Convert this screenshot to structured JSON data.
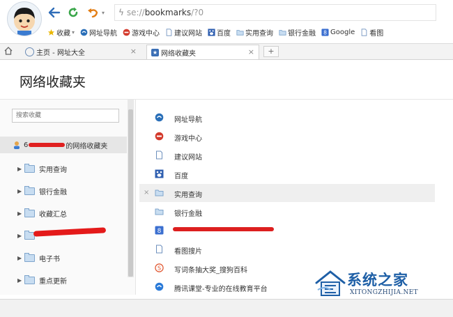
{
  "browser": {
    "address": {
      "scheme": "se://",
      "path": "bookmarks",
      "hash": "/?0"
    },
    "bookmarks_bar": [
      {
        "label": "收藏",
        "icon": "star-icon",
        "color": "#e9b600"
      },
      {
        "label": "网址导航",
        "icon": "sogou-nav-icon",
        "color": "#2a6fb8"
      },
      {
        "label": "游戏中心",
        "icon": "game-center-icon",
        "color": "#d33a2c"
      },
      {
        "label": "建议网站",
        "icon": "page-icon",
        "color": "#6c8fbd"
      },
      {
        "label": "百度",
        "icon": "baidu-icon",
        "color": "#2f5fb0"
      },
      {
        "label": "实用查询",
        "icon": "folder-icon",
        "color": "#7fa5cc"
      },
      {
        "label": "银行金融",
        "icon": "folder-icon",
        "color": "#7fa5cc"
      },
      {
        "label": "Google",
        "icon": "google-icon",
        "color": "#3b6fd0"
      },
      {
        "label": "看图",
        "icon": "page-icon",
        "color": "#6c8fbd"
      }
    ],
    "tabs": [
      {
        "label": "主页 - 网址大全",
        "active": false
      },
      {
        "label": "网络收藏夹",
        "active": true
      }
    ],
    "new_tab": "+"
  },
  "page": {
    "title": "网络收藏夹"
  },
  "sidebar": {
    "search_placeholder": "搜索收藏",
    "root": {
      "prefix": "6",
      "suffix": "的网络收藏夹"
    },
    "folders": [
      {
        "label": "实用查询"
      },
      {
        "label": "银行金融"
      },
      {
        "label": "收藏汇总"
      },
      {
        "label": ""
      },
      {
        "label": "电子书"
      },
      {
        "label": "重点更新"
      }
    ]
  },
  "main": {
    "items": [
      {
        "label": "网址导航",
        "icon": "sogou-nav-icon",
        "color": "#2a6fb8"
      },
      {
        "label": "游戏中心",
        "icon": "game-center-icon",
        "color": "#d33a2c"
      },
      {
        "label": "建议网站",
        "icon": "page-icon",
        "color": "#6c8fbd"
      },
      {
        "label": "百度",
        "icon": "baidu-icon",
        "color": "#2f5fb0"
      },
      {
        "label": "实用查询",
        "icon": "folder-icon",
        "color": "#7fa5cc",
        "highlighted": true,
        "close": "×"
      },
      {
        "label": "银行金融",
        "icon": "folder-icon",
        "color": "#7fa5cc"
      },
      {
        "label": "",
        "icon": "google-icon",
        "color": "#3b6fd0",
        "redacted": true
      },
      {
        "label": "看图搜片",
        "icon": "page-icon",
        "color": "#6c8fbd"
      },
      {
        "label": "写词条抽大奖_搜狗百科",
        "icon": "sogou-baike-icon",
        "color": "#e0522a"
      },
      {
        "label": "腾讯课堂-专业的在线教育平台",
        "icon": "tencent-class-icon",
        "color": "#2a7ad8"
      }
    ]
  },
  "watermark": {
    "cn": "系统之家",
    "en": "XITONGZHIJIA.NET",
    "color": "#1e5fa6"
  }
}
